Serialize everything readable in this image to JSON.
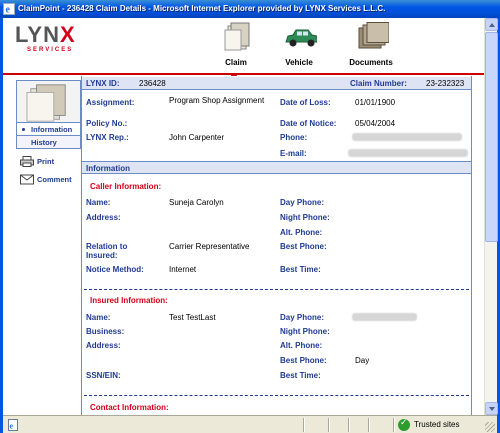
{
  "window": {
    "title": "ClaimPoint - 236428 Claim Details - Microsoft Internet Explorer provided by LYNX Services L.L.C."
  },
  "brand": {
    "logo_text": "LYNX",
    "logo_sub": "SERVICES"
  },
  "nav": {
    "items": [
      {
        "label": "Claim",
        "icon": "claim-folder-icon",
        "active": true
      },
      {
        "label": "Vehicle",
        "icon": "car-icon",
        "active": false
      },
      {
        "label": "Documents",
        "icon": "documents-icon",
        "active": false
      }
    ]
  },
  "sidebar": {
    "tabs": [
      {
        "label": "Information",
        "active": true
      },
      {
        "label": "History",
        "active": false
      }
    ],
    "links": [
      {
        "label": "Print",
        "icon": "printer-icon"
      },
      {
        "label": "Comment",
        "icon": "envelope-icon"
      }
    ]
  },
  "summary": {
    "lynx_id_label": "LYNX ID:",
    "lynx_id": "236428",
    "claim_number_label": "Claim Number:",
    "claim_number": "23-232323"
  },
  "claim": {
    "assignment_label": "Assignment:",
    "assignment": "Program Shop Assignment",
    "policy_label": "Policy No.:",
    "policy": "",
    "rep_label": "LYNX Rep.:",
    "rep": "John Carpenter",
    "date_of_loss_label": "Date of Loss:",
    "date_of_loss": "01/01/1900",
    "date_of_notice_label": "Date of Notice:",
    "date_of_notice": "05/04/2004",
    "phone_label": "Phone:",
    "email_label": "E-mail:"
  },
  "information": {
    "section_title": "Information",
    "caller": {
      "heading": "Caller Information:",
      "name_label": "Name:",
      "name": "Suneja Carolyn",
      "address_label": "Address:",
      "relation_label": "Relation to Insured:",
      "relation": "Carrier Representative",
      "notice_method_label": "Notice Method:",
      "notice_method": "Internet",
      "day_phone_label": "Day Phone:",
      "night_phone_label": "Night Phone:",
      "alt_phone_label": "Alt. Phone:",
      "best_phone_label": "Best Phone:",
      "best_time_label": "Best Time:"
    },
    "insured": {
      "heading": "Insured Information:",
      "name_label": "Name:",
      "name": "Test TestLast",
      "business_label": "Business:",
      "address_label": "Address:",
      "ssn_label": "SSN/EIN:",
      "day_phone_label": "Day Phone:",
      "night_phone_label": "Night Phone:",
      "alt_phone_label": "Alt. Phone:",
      "best_phone_label": "Best Phone:",
      "best_phone": "Day",
      "best_time_label": "Best Time:"
    },
    "contact": {
      "heading": "Contact Information:"
    }
  },
  "status": {
    "zone": "Trusted sites"
  },
  "colors": {
    "title_bar": "#0055e5",
    "accent_red": "#d4001a",
    "label_blue": "#1f3a93",
    "section_bg": "#dfe4f5"
  }
}
